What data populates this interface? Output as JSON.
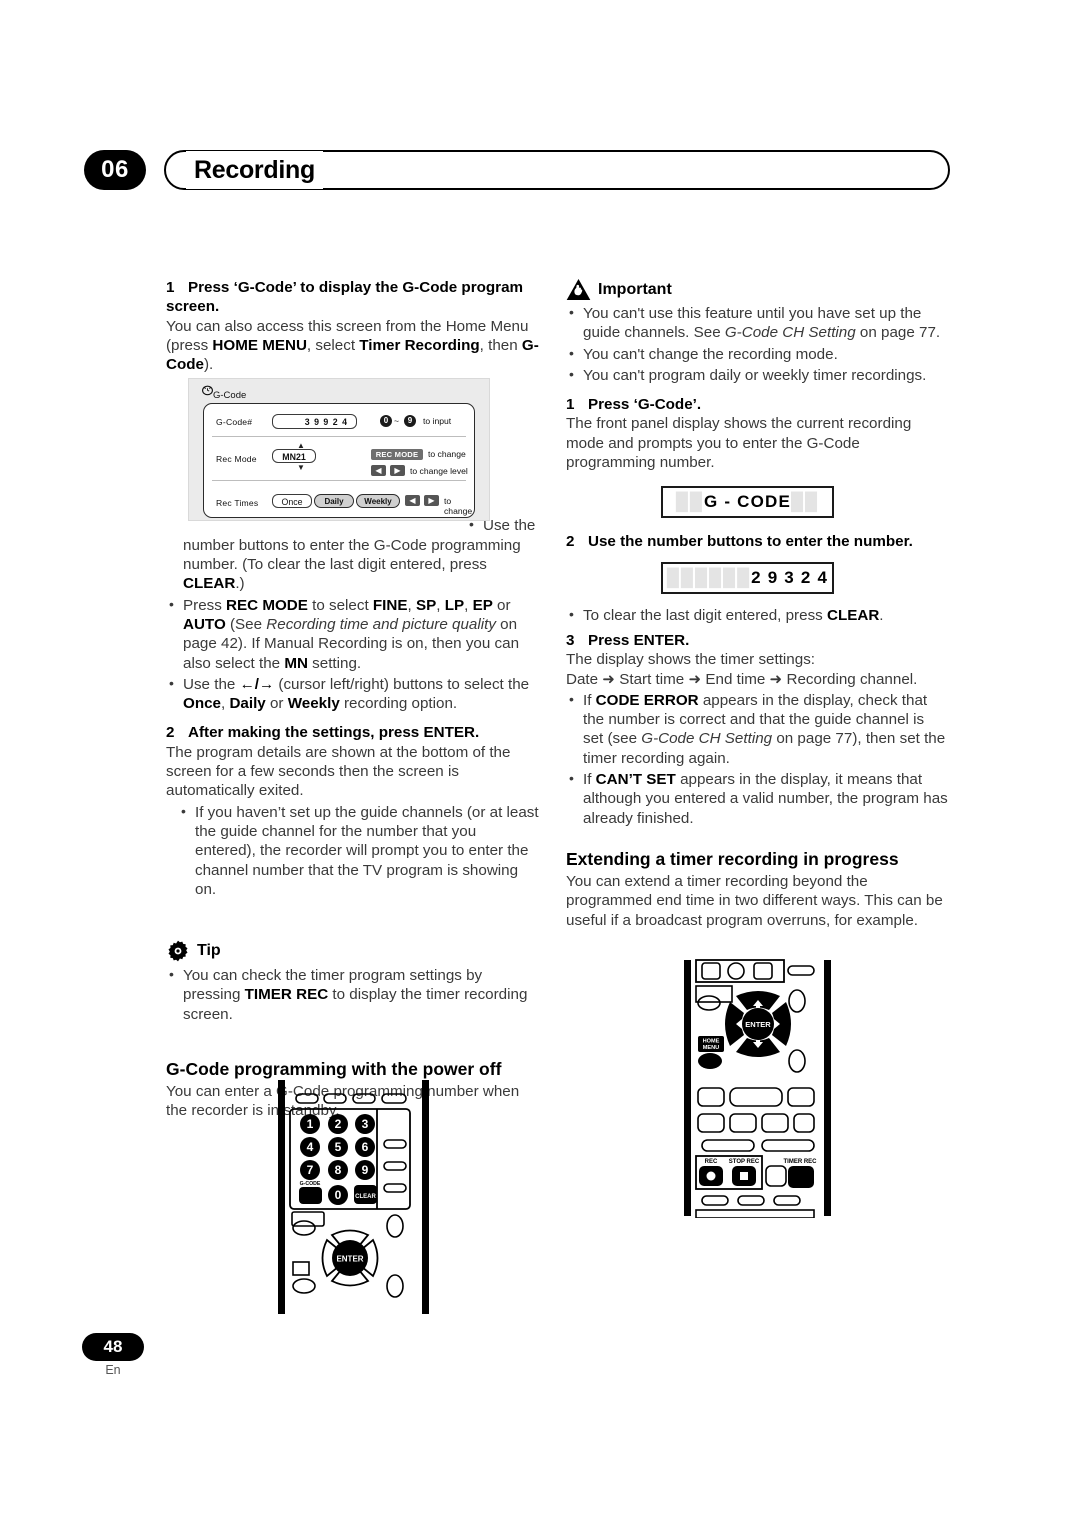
{
  "header": {
    "chapter_number": "06",
    "title": "Recording"
  },
  "footer": {
    "page_number": "48",
    "language": "En"
  },
  "left_column": {
    "step1_heading_num": "1",
    "step1_heading": "Press ‘G-Code’ to display the G-Code program screen.",
    "step1_body_1": "You can also access this screen from the Home Menu (press ",
    "step1_body_bold_1": "HOME MENU",
    "step1_body_2": ", select ",
    "step1_body_bold_2": "Timer Recording",
    "step1_body_3": ", then ",
    "step1_body_bold_3": "G-Code",
    "step1_body_4": ").",
    "bullet1_a": "Use the number buttons to enter the G-Code programming number. (To clear the last digit entered, press ",
    "bullet1_bold": "CLEAR",
    "bullet1_b": ".)",
    "bullet2_a": "Press ",
    "bullet2_bold_recmode": "REC MODE",
    "bullet2_b": " to select ",
    "bullet2_bold_fine": "FINE",
    "bullet2_c": ", ",
    "bullet2_bold_sp": "SP",
    "bullet2_d": ", ",
    "bullet2_bold_lp": "LP",
    "bullet2_e": ", ",
    "bullet2_bold_ep": "EP",
    "bullet2_f": " or ",
    "bullet2_bold_auto": "AUTO",
    "bullet2_g": " (See ",
    "bullet2_italic": "Recording time and picture quality",
    "bullet2_h": " on page 42). If Manual Recording is on, then you can also select the ",
    "bullet2_bold_mn": "MN",
    "bullet2_i": " setting.",
    "bullet3_a": "Use the ",
    "bullet3_arrows": "←/→",
    "bullet3_b": " (cursor left/right) buttons to select the ",
    "bullet3_bold_once": "Once",
    "bullet3_c": ", ",
    "bullet3_bold_daily": "Daily",
    "bullet3_d": " or ",
    "bullet3_bold_weekly": "Weekly",
    "bullet3_e": " recording option.",
    "step2_heading_num": "2",
    "step2_heading": "After making the settings, press ENTER.",
    "step2_body": "The program details are shown at the bottom of the screen for a few seconds then the screen is automatically exited.",
    "step2_bullet": "If you haven’t set up the guide channels (or at least the guide channel for the number that you entered), the recorder will prompt you to enter the channel number that the TV program is showing on.",
    "tip_label": "Tip",
    "tip_bullet_a": "You can check the timer program settings by pressing ",
    "tip_bullet_bold": "TIMER REC",
    "tip_bullet_b": " to display the timer recording screen.",
    "section_heading": "G-Code programming with the power off",
    "section_body": "You can enter a G-Code programming number when the recorder is in standby."
  },
  "osd_figure": {
    "title": "G-Code",
    "row1_label": "G-Code#",
    "row1_value": "3 9 9 2 4",
    "row1_hint_from": "0",
    "row1_hint_tilde": "~",
    "row1_hint_to": "9",
    "row1_hint_text": "to input",
    "row2_label": "Rec  Mode",
    "row2_value": "MN21",
    "row2_key": "REC MODE",
    "row2_hint_text": "to change",
    "row2_hint_text2": "to change level",
    "row3_label": "Rec  Times",
    "row3_opt1": "Once",
    "row3_opt2": "Daily",
    "row3_opt3": "Weekly",
    "row3_hint_text": "to change"
  },
  "right_column": {
    "important_label": "Important",
    "imp_bullet1_a": "You can't use this feature until you have set up the guide channels. See ",
    "imp_bullet1_italic": "G-Code CH Setting",
    "imp_bullet1_b": " on page 77.",
    "imp_bullet2": "You can't change the recording mode.",
    "imp_bullet3": "You can't program daily or weekly timer recordings.",
    "step1_heading_num": "1",
    "step1_heading": "Press ‘G-Code’.",
    "step1_body": "The front panel display shows the current recording mode and prompts you to enter the G-Code programming number.",
    "display1_ghost_left": "██",
    "display1_text": "G - CODE",
    "display1_ghost_right": "██",
    "step2_heading_num": "2",
    "step2_heading": "Use the number buttons to enter the number.",
    "display2_ghost_left": "██████",
    "display2_text": "2 9 3 2 4",
    "step2_bullet_a": "To clear the last digit entered, press ",
    "step2_bullet_bold": "CLEAR",
    "step2_bullet_b": ".",
    "step3_heading_num": "3",
    "step3_heading": "Press ENTER.",
    "step3_body_1": "The display shows the timer settings:",
    "step3_body_2": "Date ➜ Start time ➜ End time ➜ Recording channel.",
    "step3_bullet1_a": "If ",
    "step3_bullet1_bold": "CODE ERROR",
    "step3_bullet1_b": " appears in the display, check that the number is correct and that the guide channel is set (see ",
    "step3_bullet1_italic": "G-Code CH Setting",
    "step3_bullet1_c": " on page 77), then set the timer recording again.",
    "step3_bullet2_a": "If ",
    "step3_bullet2_bold": "CAN’T SET",
    "step3_bullet2_b": " appears in the display, it means that although you entered a valid number, the program has already finished.",
    "section_heading": "Extending a timer recording in progress",
    "section_body": "You can extend a timer recording beyond the programmed end time in two different ways. This can be useful if a broadcast program overruns, for example."
  },
  "remote_left": {
    "keys": [
      "1",
      "2",
      "3",
      "4",
      "5",
      "6",
      "7",
      "8",
      "9",
      "0"
    ],
    "gcode_label": "G-CODE",
    "clear_label": "CLEAR",
    "enter_label": "ENTER"
  },
  "remote_right": {
    "enter_label": "ENTER",
    "home_menu_label_1": "HOME",
    "home_menu_label_2": "MENU",
    "rec_label": "REC",
    "stop_rec_label": "STOP REC",
    "timer_rec_label": "TIMER REC"
  },
  "colors": {
    "text": "#3a3a3a",
    "heading": "#000000",
    "osd_bg": "#ebebeb",
    "key_dark": "#6e6e6e"
  }
}
